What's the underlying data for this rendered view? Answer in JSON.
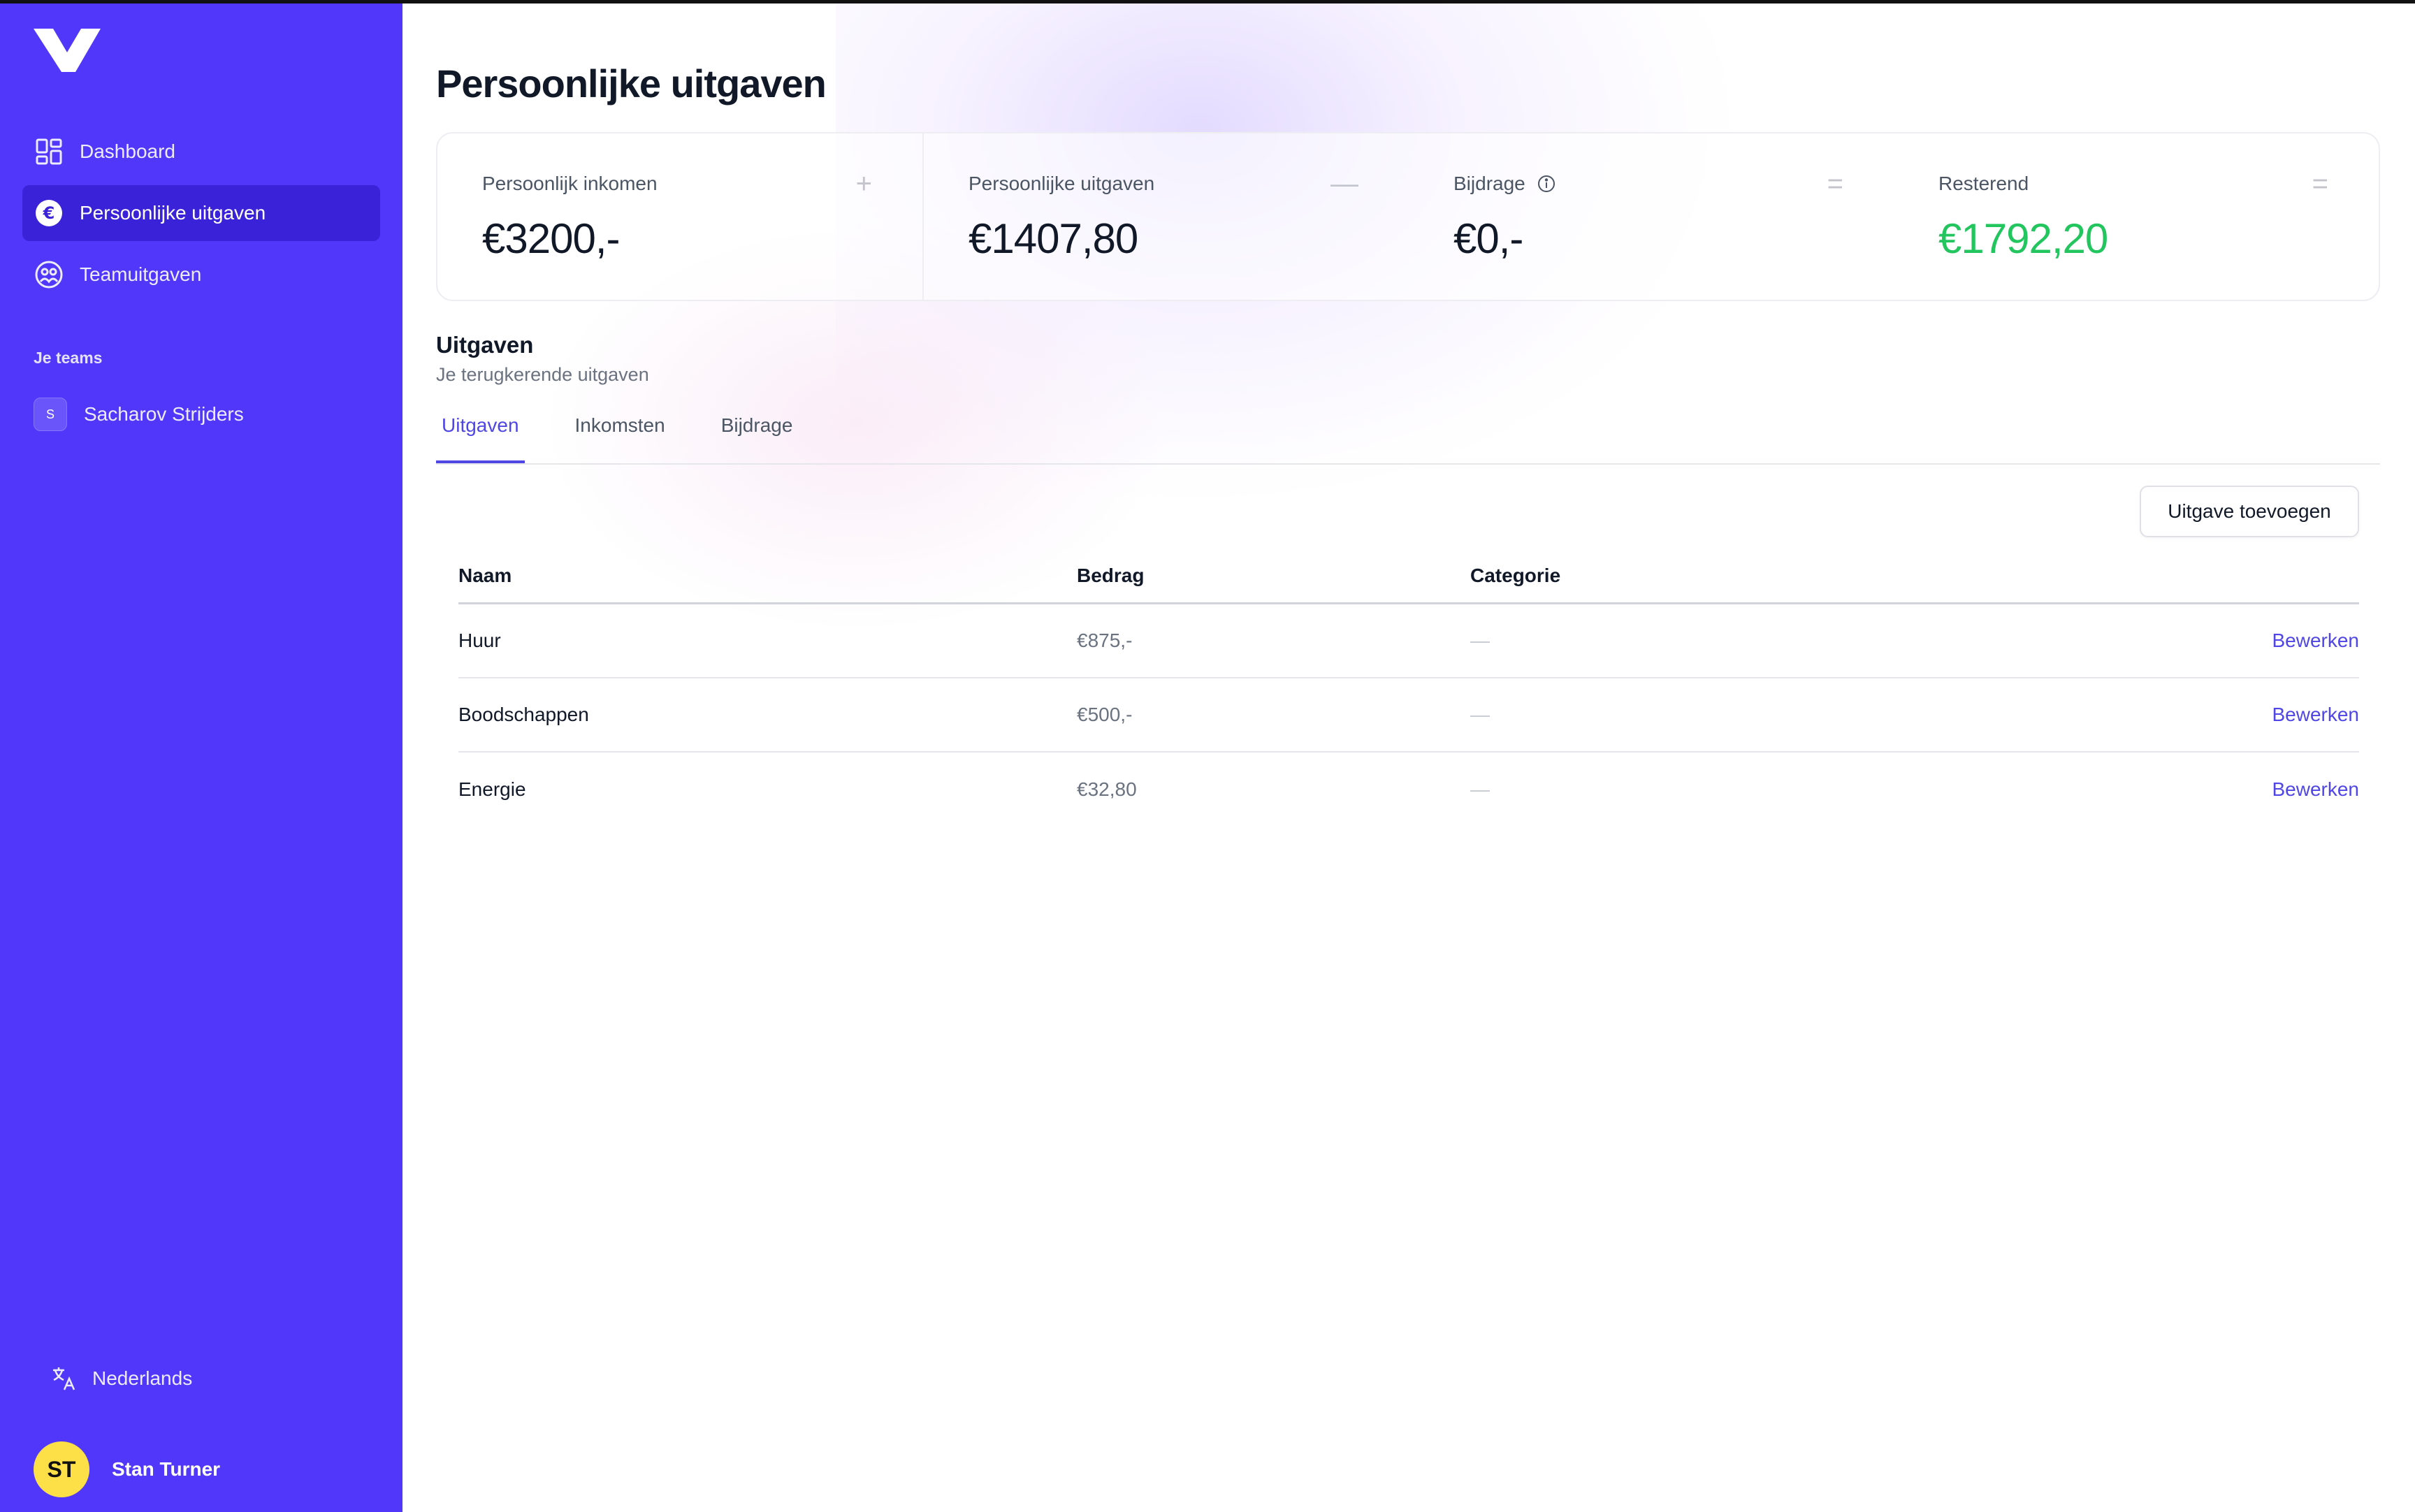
{
  "sidebar": {
    "nav": [
      {
        "label": "Dashboard",
        "icon": "grid-icon"
      },
      {
        "label": "Persoonlijke uitgaven",
        "icon": "euro-icon"
      },
      {
        "label": "Teamuitgaven",
        "icon": "team-icon"
      }
    ],
    "teams_label": "Je teams",
    "teams": [
      {
        "initial": "S",
        "name": "Sacharov Strijders"
      }
    ],
    "language": "Nederlands",
    "user": {
      "initials": "ST",
      "name": "Stan Turner"
    },
    "colors": {
      "background": "#5137F9",
      "active": "#3A22D8",
      "avatar": "#FDE047"
    }
  },
  "main": {
    "title": "Persoonlijke uitgaven",
    "stats": [
      {
        "label": "Persoonlijk inkomen",
        "value": "€3200,-",
        "operator": "+"
      },
      {
        "label": "Persoonlijke uitgaven",
        "value": "€1407,80",
        "operator": "—"
      },
      {
        "label": "Bijdrage",
        "value": "€0,-",
        "operator": "="
      },
      {
        "label": "Resterend",
        "value": "€1792,20",
        "operator": "="
      }
    ],
    "section_title": "Uitgaven",
    "section_subtitle": "Je terugkerende uitgaven",
    "tabs": [
      "Uitgaven",
      "Inkomsten",
      "Bijdrage"
    ],
    "add_button": "Uitgave toevoegen",
    "table": {
      "headers": [
        "Naam",
        "Bedrag",
        "Categorie"
      ],
      "rows": [
        {
          "name": "Huur",
          "amount": "€875,-",
          "category": "—",
          "action": "Bewerken"
        },
        {
          "name": "Boodschappen",
          "amount": "€500,-",
          "category": "—",
          "action": "Bewerken"
        },
        {
          "name": "Energie",
          "amount": "€32,80",
          "category": "—",
          "action": "Bewerken"
        }
      ]
    },
    "colors": {
      "accent": "#4F46E5",
      "positive": "#22C55E"
    }
  }
}
